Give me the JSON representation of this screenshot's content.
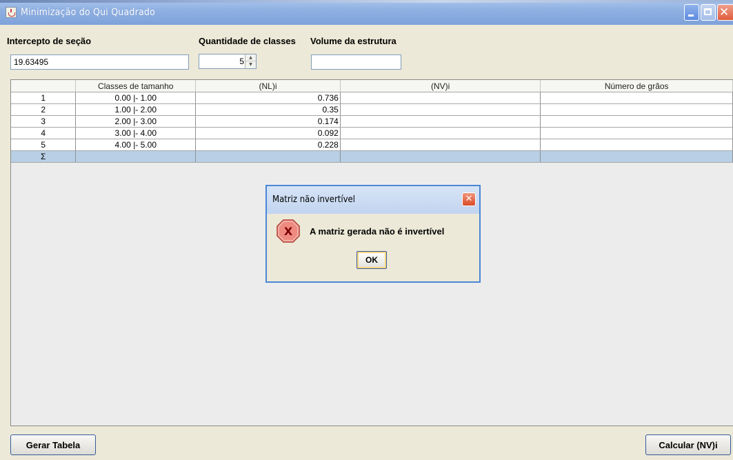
{
  "window": {
    "title": "Minimização do Qui Quadrado"
  },
  "labels": {
    "intercepto": "Intercepto de seção",
    "quantidade": "Quantidade de classes",
    "volume": "Volume da estrutura"
  },
  "inputs": {
    "intercepto_value": "19.63495",
    "quantidade_value": "5",
    "volume_value": ""
  },
  "table": {
    "columns": [
      "",
      "Classes de tamanho",
      "(NL)i",
      "(NV)i",
      "Número de grãos"
    ],
    "rows": [
      [
        "1",
        "0.00 |- 1.00",
        "0.736",
        "",
        ""
      ],
      [
        "2",
        "1.00 |- 2.00",
        "0.35",
        "",
        ""
      ],
      [
        "3",
        "2.00 |- 3.00",
        "0.174",
        "",
        ""
      ],
      [
        "4",
        "3.00 |- 4.00",
        "0.092",
        "",
        ""
      ],
      [
        "5",
        "4.00 |- 5.00",
        "0.228",
        "",
        ""
      ],
      [
        "Σ",
        "",
        "",
        "",
        ""
      ]
    ]
  },
  "buttons": {
    "gerar": "Gerar Tabela",
    "calcular": "Calcular (NV)i"
  },
  "dialog": {
    "title": "Matriz não invertível",
    "message": "A matriz gerada não é invertível",
    "ok": "OK"
  },
  "colors": {
    "accent": "#4a86d6",
    "sum_row": "#b8cfe5",
    "window_bg": "#ece9d8"
  }
}
